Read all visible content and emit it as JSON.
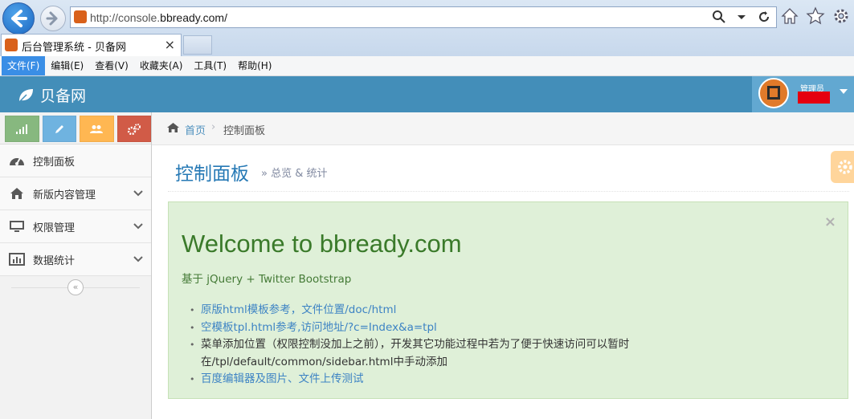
{
  "browser": {
    "url_prefix": "http://console.",
    "url_host": "bbready.com/",
    "tab_title": "后台管理系统 - 贝备网",
    "tab_close": "×",
    "menu": [
      "文件(F)",
      "编辑(E)",
      "查看(V)",
      "收藏夹(A)",
      "工具(T)",
      "帮助(H)"
    ]
  },
  "navbar": {
    "brand": "贝备网",
    "user_welcome": "管理员",
    "brand_color": "#438eb9"
  },
  "sidebar": {
    "items": [
      {
        "label": "控制面板",
        "icon": "dashboard-icon",
        "has_submenu": false
      },
      {
        "label": "新版内容管理",
        "icon": "home-icon",
        "has_submenu": true
      },
      {
        "label": "权限管理",
        "icon": "desktop-icon",
        "has_submenu": true
      },
      {
        "label": "数据统计",
        "icon": "bar-chart-icon",
        "has_submenu": true
      }
    ],
    "collapse_glyph": "«",
    "shortcut_colors": [
      "#87b87f",
      "#6fb3e0",
      "#ffb752",
      "#d15b47"
    ]
  },
  "breadcrumb": {
    "home": "首页",
    "separator": "›",
    "current": "控制面板"
  },
  "page": {
    "title": "控制面板",
    "subtitle": "» 总览 & 统计"
  },
  "alert": {
    "close": "×",
    "heading": "Welcome to bbready.com",
    "subheading": "基于 jQuery + Twitter Bootstrap",
    "notes": [
      "原版html模板参考，文件位置/doc/html",
      "空模板tpl.html参考,访问地址/?c=Index&a=tpl",
      "菜单添加位置（权限控制没加上之前），开发其它功能过程中若为了便于快速访问可以暂时",
      "在/tpl/default/common/sidebar.html中手动添加",
      "百度编辑器及图片、文件上传测试"
    ]
  }
}
